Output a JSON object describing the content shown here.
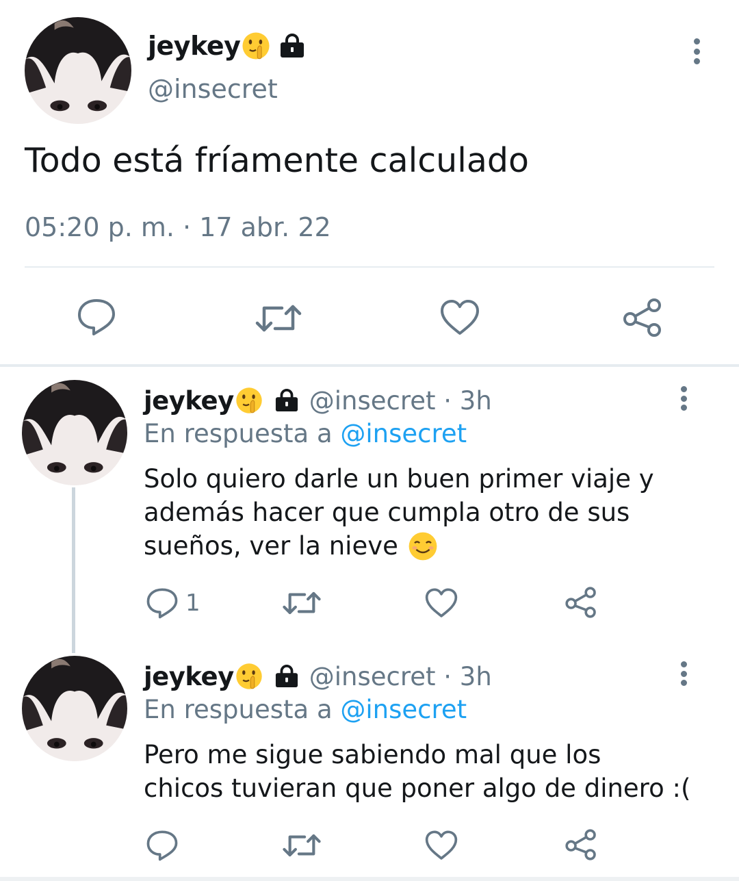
{
  "main_tweet": {
    "name": "jeykey",
    "handle": "@insecret",
    "text": "Todo está fríamente calculado",
    "timestamp": "05:20 p. m. · 17 abr. 22",
    "icons": [
      "shushing-face-emoji",
      "lock-icon",
      "more-icon",
      "reply-icon",
      "retweet-icon",
      "like-icon",
      "share-icon"
    ]
  },
  "replies": [
    {
      "name": "jeykey",
      "meta": "@insecret · 3h",
      "reply_prefix": "En respuesta a ",
      "reply_mention": "@insecret",
      "text_lines": [
        "Solo quiero darle un buen primer viaje y",
        "además hacer que cumpla otro de sus",
        "sueños, ver la nieve"
      ],
      "trailing_emoji": "smiling-face-emoji",
      "reply_count": "1"
    },
    {
      "name": "jeykey",
      "meta": "@insecret · 3h",
      "reply_prefix": "En respuesta a ",
      "reply_mention": "@insecret",
      "text_lines": [
        "Pero me sigue sabiendo mal que los",
        "chicos tuvieran que poner algo de dinero :("
      ],
      "reply_count": ""
    }
  ],
  "colors": {
    "text": "#14171a",
    "secondary": "#657786",
    "link": "#1da1f2",
    "divider": "#e6ecf0",
    "thread_line": "#ccd6dd"
  }
}
